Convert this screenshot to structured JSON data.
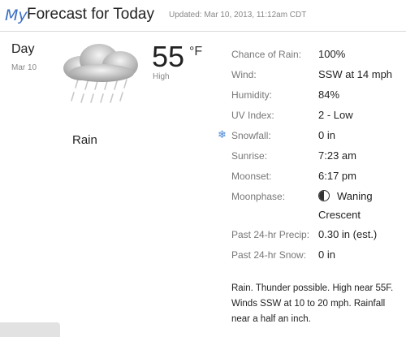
{
  "header": {
    "brand": "My",
    "title": "Forecast for Today",
    "updated": "Updated: Mar 10, 2013, 11:12am CDT"
  },
  "summary": {
    "period": "Day",
    "date": "Mar 10",
    "icon": "rain-cloud-icon",
    "temperature": "55",
    "unit": "°F",
    "temp_type": "High",
    "condition": "Rain"
  },
  "details": [
    {
      "label": "Chance of Rain:",
      "value": "100%"
    },
    {
      "label": "Wind:",
      "value": "SSW at 14 mph"
    },
    {
      "label": "Humidity:",
      "value": "84%"
    },
    {
      "label": "UV Index:",
      "value": "2 - Low"
    },
    {
      "label": "Snowfall:",
      "value": "0 in"
    },
    {
      "label": "Sunrise:",
      "value": "7:23 am"
    },
    {
      "label": "Moonset:",
      "value": "6:17 pm"
    }
  ],
  "moonphase": {
    "label": "Moonphase:",
    "icon": "waning-crescent-moon-icon",
    "value_line1": "Waning",
    "value_line2": "Crescent"
  },
  "precip": [
    {
      "label": "Past 24-hr Precip:",
      "value": "0.30 in (est.)"
    },
    {
      "label": "Past 24-hr Snow:",
      "value": "0 in"
    }
  ],
  "description": "Rain. Thunder possible. High near 55F. Winds SSW at 10 to 20 mph. Rainfall near a half an inch."
}
